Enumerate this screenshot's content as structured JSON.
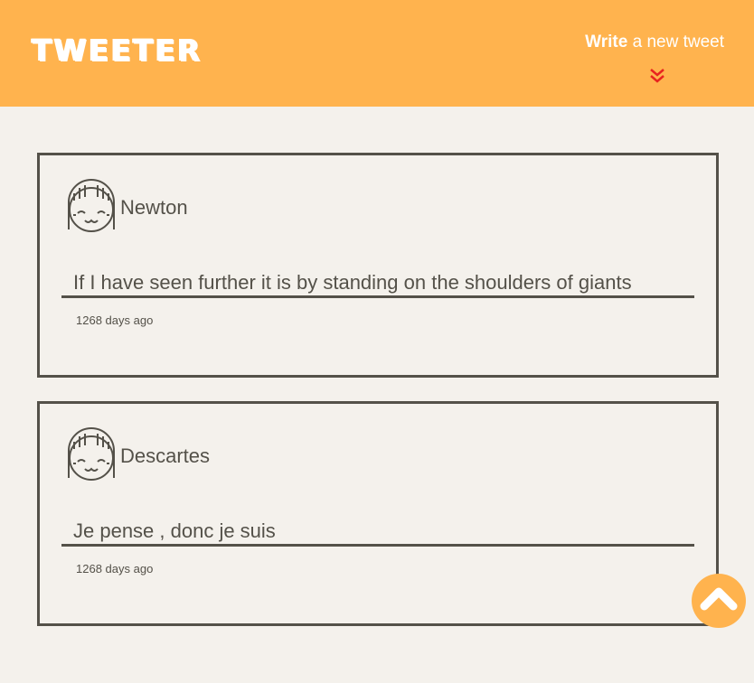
{
  "header": {
    "logo": "TWEETER",
    "compose_bold": "Write",
    "compose_rest": " a new tweet",
    "compose_icon": "double-chevron-down-icon",
    "brand_color": "#ffb34e",
    "accent_color": "#e8231f"
  },
  "tweets": [
    {
      "handle": "Newton",
      "content": "If I have seen further it is by standing on the shoulders of giants",
      "timestamp": "1268 days ago",
      "avatar_icon": "face-avatar-icon"
    },
    {
      "handle": "Descartes",
      "content": "Je pense , donc je suis",
      "timestamp": "1268 days ago",
      "avatar_icon": "face-avatar-icon"
    }
  ],
  "scroll_top": {
    "icon": "chevron-up-icon"
  }
}
